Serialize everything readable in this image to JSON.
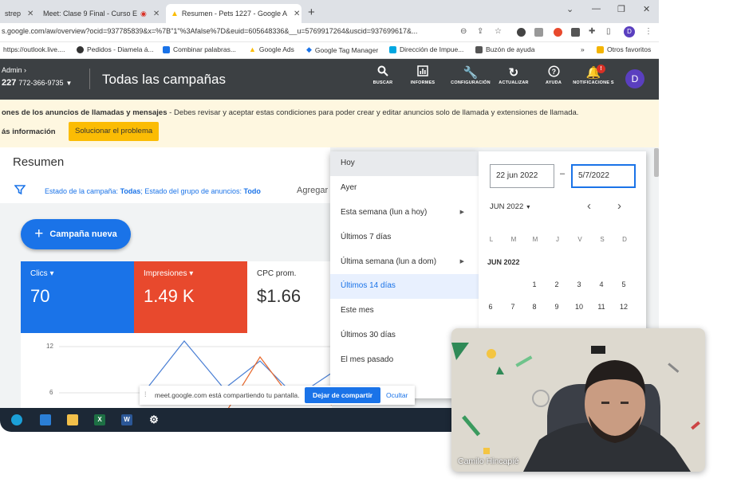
{
  "browser": {
    "tabs": [
      {
        "title": "strep",
        "active": false
      },
      {
        "title": "Meet: Clase 9 Final - Curso E",
        "active": false
      },
      {
        "title": "Resumen - Pets 1227 - Google A",
        "active": true
      }
    ],
    "new_tab": "+",
    "window_controls": [
      "⌄",
      "—",
      "❐",
      "✕"
    ],
    "url": "s.google.com/aw/overview?ocid=937785839&x=%7B\"1\"%3Afalse%7D&euid=605648336&__u=5769917264&uscid=937699617&...",
    "profile_initial": "D",
    "bookmarks": [
      "https://outlook.live....",
      "Pedidos - Diamela á...",
      "Combinar palabras...",
      "Google Ads",
      "Google Tag Manager",
      "Dirección de Impue...",
      "Buzón de ayuda"
    ],
    "more_bookmarks": "»",
    "other_favorites": "Otros favoritos"
  },
  "ads": {
    "account_label": "Admin",
    "account_id": "227",
    "phone": "772-366-9735",
    "page_title": "Todas las campañas",
    "tools": [
      {
        "label": "BUSCAR",
        "icon": "search-icon"
      },
      {
        "label": "INFORMES",
        "icon": "reports-icon"
      },
      {
        "label": "CONFIGURACIÓN",
        "icon": "wrench-icon"
      },
      {
        "label": "ACTUALIZAR",
        "icon": "refresh-icon"
      },
      {
        "label": "AYUDA",
        "icon": "help-icon"
      },
      {
        "label": "NOTIFICACIONE S",
        "icon": "bell-icon"
      }
    ],
    "notification_badge": "!",
    "user_initial": "D"
  },
  "warning": {
    "text_bold": "ones de los anuncios de llamadas y mensajes",
    "text": " - Debes revisar y aceptar estas condiciones para poder crear y editar anuncios solo de llamada y extensiones de llamada.",
    "more_link": "ás información",
    "fix_button": "Solucionar el problema"
  },
  "main": {
    "summary_title": "Resumen",
    "filter_prefix": "Estado de la campaña: ",
    "filter_v1": "Todas",
    "filter_mid": "; Estado del grupo de anuncios: ",
    "filter_v2": "Todo",
    "add_filter": "Agregar",
    "new_campaign": "Campaña nueva",
    "cards": [
      {
        "label": "Clics ▾",
        "value": "70",
        "color": "#1a73e8"
      },
      {
        "label": "Impresiones ▾",
        "value": "1.49 K",
        "color": "#e8492d"
      },
      {
        "label": "CPC prom.",
        "value": "$1.66",
        "color": "#ffffff"
      }
    ],
    "y_ticks": [
      "12",
      "6"
    ]
  },
  "date_range_menu": {
    "items": [
      {
        "label": "Hoy",
        "submenu": false
      },
      {
        "label": "Ayer",
        "submenu": false
      },
      {
        "label": "Esta semana (lun a hoy)",
        "submenu": true
      },
      {
        "label": "Últimos 7 días",
        "submenu": false
      },
      {
        "label": "Última semana (lun a dom)",
        "submenu": true
      },
      {
        "label": "Últimos 14 días",
        "submenu": false
      },
      {
        "label": "Este mes",
        "submenu": false
      },
      {
        "label": "Últimos 30 días",
        "submenu": false
      },
      {
        "label": "El mes pasado",
        "submenu": false
      }
    ],
    "hovered": "Hoy",
    "selected": "Últimos 14 días"
  },
  "calendar": {
    "start_date": "22 jun 2022",
    "end_date": "5/7/2022",
    "separator": "–",
    "month_select": "JUN 2022",
    "weekdays": [
      "L",
      "M",
      "M",
      "J",
      "V",
      "S",
      "D"
    ],
    "month_label": "JUN 2022",
    "week1": [
      "1",
      "2",
      "3",
      "4",
      "5"
    ],
    "week2": [
      "6",
      "7",
      "8",
      "9",
      "10",
      "11",
      "12"
    ]
  },
  "share_notice": {
    "message": "meet.google.com está compartiendo tu pantalla.",
    "stop_button": "Dejar de compartir",
    "hide_link": "Ocultar"
  },
  "taskbar": [
    "edge-icon",
    "mail-icon",
    "folder-icon",
    "excel-icon",
    "word-icon",
    "settings-icon"
  ],
  "video": {
    "participant_name": "Camilo Hincapié"
  }
}
